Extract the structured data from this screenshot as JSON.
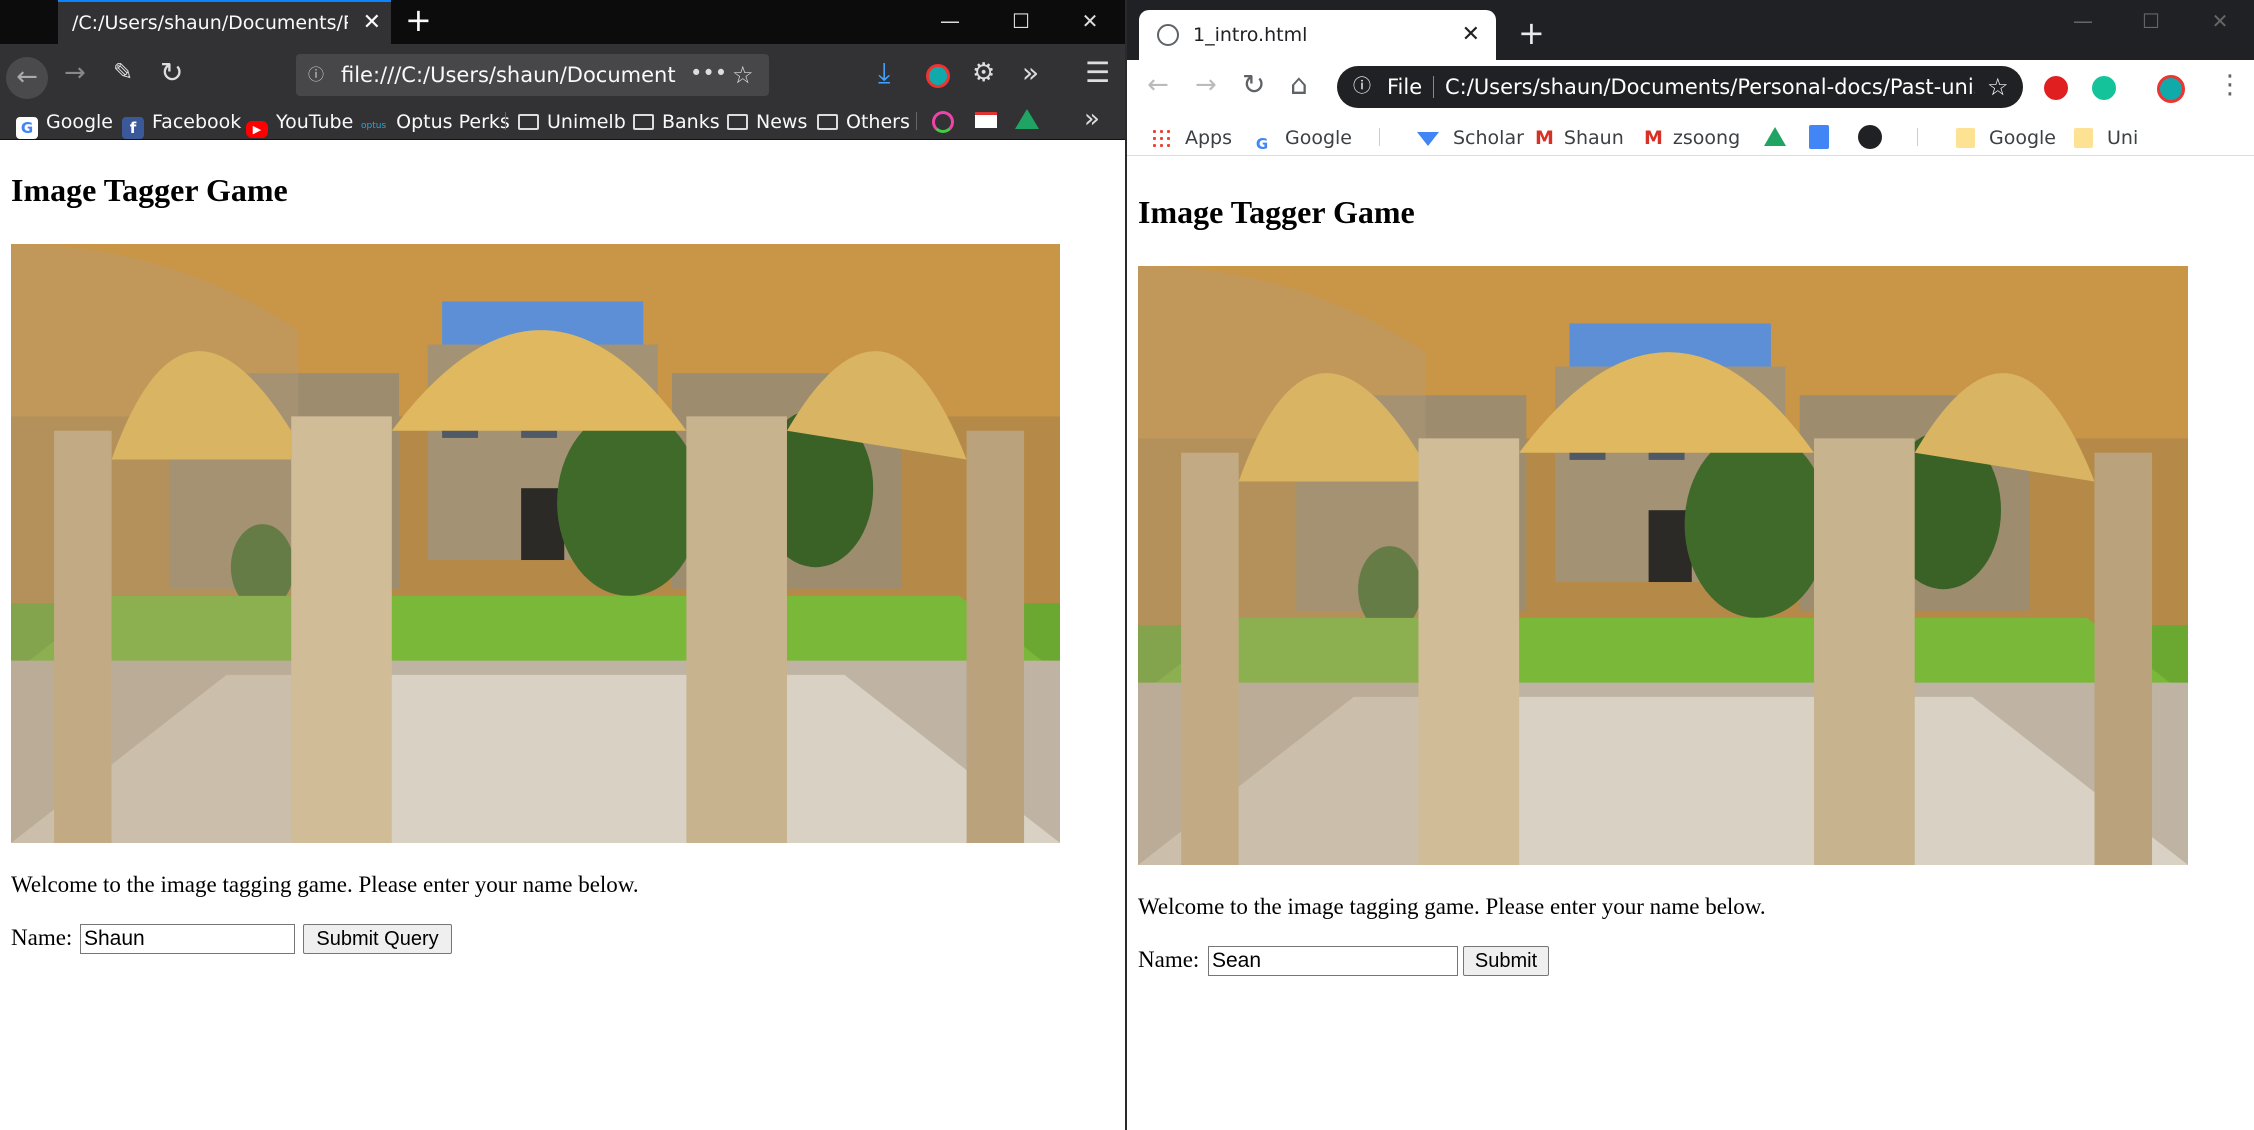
{
  "firefox": {
    "tab_title": "/C:/Users/shaun/Documents/Personal",
    "url": "file:///C:/Users/shaun/Document",
    "bookmarks": [
      "Google",
      "Facebook",
      "YouTube",
      "Optus Perks",
      "Unimelb",
      "Banks",
      "News",
      "Others"
    ],
    "page": {
      "heading": "Image Tagger Game",
      "welcome": "Welcome to the image tagging game. Please enter your name below.",
      "name_label": "Name:",
      "name_value": "Shaun",
      "submit_label": "Submit Query"
    }
  },
  "chrome": {
    "tab_title": "1_intro.html",
    "url_scheme": "File",
    "url": "C:/Users/shaun/Documents/Personal-docs/Past-unishi...",
    "bookmarks": [
      "Apps",
      "Google",
      "Scholar",
      "Shaun",
      "zsoong",
      "Google",
      "Uni"
    ],
    "page": {
      "heading": "Image Tagger Game",
      "welcome": "Welcome to the image tagging game. Please enter your name below.",
      "name_label": "Name:",
      "name_value": "Sean",
      "submit_label": "Submit"
    }
  },
  "colors": {
    "firefox_dark": "#323234",
    "firefox_tabbar": "#0c0c0d",
    "firefox_accent": "#0a84ff",
    "chrome_dark": "#202124"
  }
}
